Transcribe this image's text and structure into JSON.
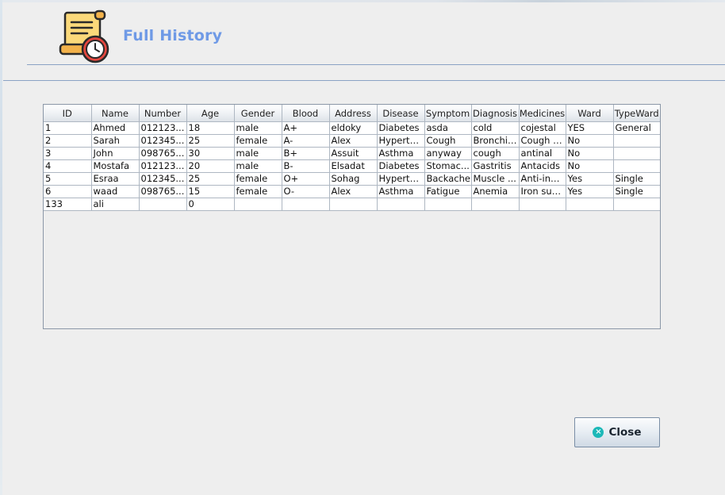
{
  "header": {
    "title": "Full History",
    "icon": "scroll-clock-icon"
  },
  "table": {
    "columns": [
      "ID",
      "Name",
      "Number",
      "Age",
      "Gender",
      "Blood",
      "Address",
      "Disease",
      "Symptom",
      "Diagnosis",
      "Medicines",
      "Ward",
      "TypeWard"
    ],
    "rows": [
      [
        "1",
        "Ahmed",
        "012123...",
        "18",
        "male",
        "A+",
        "eldoky",
        "Diabetes",
        "asda",
        "cold",
        "cojestal",
        "YES",
        "General"
      ],
      [
        "2",
        "Sarah",
        "012345...",
        "25",
        "female",
        "A-",
        "Alex",
        "Hyperte...",
        "Cough",
        "Bronchitis",
        "Cough s...",
        "No",
        ""
      ],
      [
        "3",
        "John",
        "098765...",
        "30",
        "male",
        "B+",
        "Assuit",
        "Asthma",
        "anyway",
        "cough",
        "antinal",
        "No",
        ""
      ],
      [
        "4",
        "Mostafa",
        "012123...",
        "20",
        "male",
        "B-",
        "Elsadat",
        "Diabetes",
        "Stomac...",
        "Gastritis",
        "Antacids",
        "No",
        ""
      ],
      [
        "5",
        "Esraa",
        "012345...",
        "25",
        "female",
        "O+",
        "Sohag",
        "Hyperte...",
        "Backache",
        "Muscle ...",
        "Anti-infla...",
        "Yes",
        "Single"
      ],
      [
        "6",
        "waad",
        "098765...",
        "15",
        "female",
        "O-",
        "Alex",
        "Asthma",
        "Fatigue",
        "Anemia",
        "Iron sup...",
        "Yes",
        "Single"
      ],
      [
        "133",
        "ali",
        "",
        "0",
        "",
        "",
        "",
        "",
        "",
        "",
        "",
        "",
        ""
      ]
    ]
  },
  "buttons": {
    "close_label": "Close",
    "close_icon": "close-circle-icon"
  },
  "colors": {
    "title": "#6f9ae6",
    "close_icon": "#1cb8b8",
    "divider": "#8aa2c4"
  }
}
